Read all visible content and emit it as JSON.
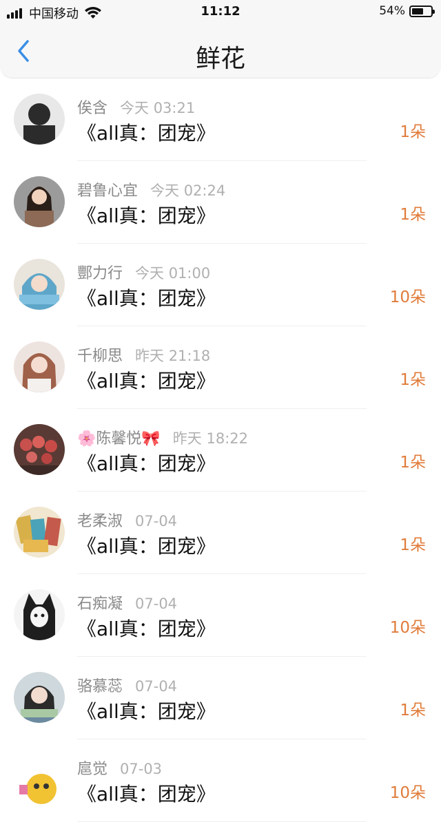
{
  "status": {
    "carrier": "中国移动",
    "time": "11:12",
    "battery": "54%"
  },
  "nav": {
    "title": "鲜花"
  },
  "items": [
    {
      "name": "俟含",
      "time": "今天 03:21",
      "book": "《all真：团宠》",
      "count": "1朵",
      "avatar_color": "#2b2b2b"
    },
    {
      "name": "碧鲁心宜",
      "time": "今天 02:24",
      "book": "《all真：团宠》",
      "count": "1朵",
      "avatar_color": "#8c6a55"
    },
    {
      "name": "酆力行",
      "time": "今天 01:00",
      "book": "《all真：团宠》",
      "count": "10朵",
      "avatar_color": "#5ea6c9"
    },
    {
      "name": "千柳思",
      "time": "昨天 21:18",
      "book": "《all真：团宠》",
      "count": "1朵",
      "avatar_color": "#c7a09a"
    },
    {
      "name": "🌸陈馨悦🎀",
      "time": "昨天 18:22",
      "book": "《all真：团宠》",
      "count": "1朵",
      "avatar_color": "#8c3d3d"
    },
    {
      "name": "老柔淑",
      "time": "07-04",
      "book": "《all真：团宠》",
      "count": "1朵",
      "avatar_color": "#d7b04a"
    },
    {
      "name": "石痴凝",
      "time": "07-04",
      "book": "《all真：团宠》",
      "count": "10朵",
      "avatar_color": "#1e1e1e"
    },
    {
      "name": "骆慕蕊",
      "time": "07-04",
      "book": "《all真：团宠》",
      "count": "1朵",
      "avatar_color": "#6b8aa0"
    },
    {
      "name": "扈觉",
      "time": "07-03",
      "book": "《all真：团宠》",
      "count": "10朵",
      "avatar_color": "#f1c232"
    }
  ]
}
